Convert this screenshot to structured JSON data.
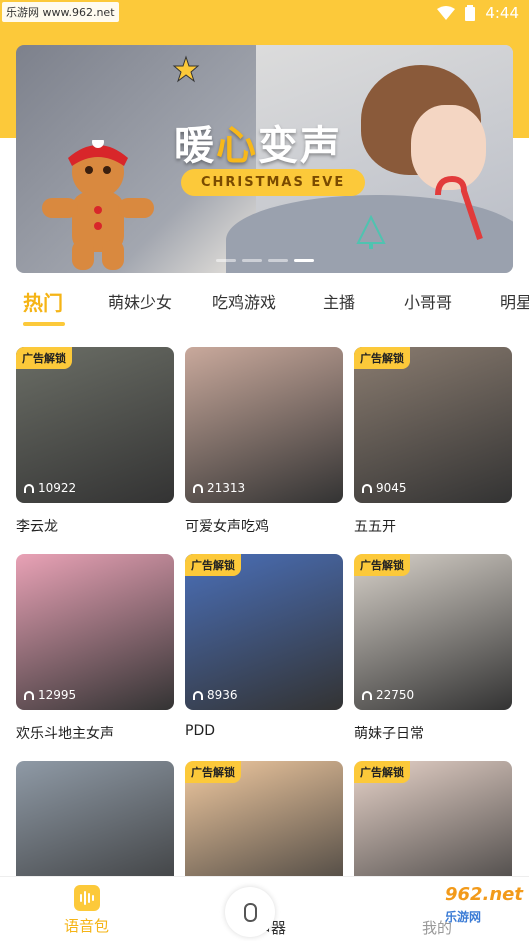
{
  "status_bar": {
    "left_text": "乐游网 www.962.net",
    "time": "4:44"
  },
  "banner": {
    "title_left": "暖",
    "title_mid": "心",
    "title_right": "变声",
    "subtitle": "CHRISTMAS EVE",
    "page_count": 4,
    "active_page": 3
  },
  "tabs": [
    "热门",
    "萌妹少女",
    "吃鸡游戏",
    "主播",
    "小哥哥",
    "明星"
  ],
  "active_tab": 0,
  "ad_badge": "广告解锁",
  "cards": [
    {
      "title": "李云龙",
      "plays": "10922",
      "ad": true,
      "color": "#6b6e66"
    },
    {
      "title": "可爱女声吃鸡",
      "plays": "21313",
      "ad": false,
      "color": "#c9a99c"
    },
    {
      "title": "五五开",
      "plays": "9045",
      "ad": true,
      "color": "#8a7c70"
    },
    {
      "title": "欢乐斗地主女声",
      "plays": "12995",
      "ad": false,
      "color": "#e9a2b6"
    },
    {
      "title": "PDD",
      "plays": "8936",
      "ad": true,
      "color": "#4a6fb8"
    },
    {
      "title": "萌妹子日常",
      "plays": "22750",
      "ad": true,
      "color": "#d7d1c9"
    },
    {
      "title": "",
      "plays": "",
      "ad": false,
      "color": "#8f9aa6"
    },
    {
      "title": "",
      "plays": "",
      "ad": true,
      "color": "#f0c9a0"
    },
    {
      "title": "",
      "plays": "",
      "ad": true,
      "color": "#e6d2c8"
    }
  ],
  "bottom_nav": [
    {
      "label": "语音包",
      "icon": "voice-pack-icon",
      "active": true
    },
    {
      "label": "变声器",
      "icon": "microphone-icon",
      "active": false
    },
    {
      "label": "我的",
      "icon": "profile-icon",
      "active": false
    }
  ],
  "watermark": {
    "main": "962.net",
    "sub": "乐游网"
  },
  "colors": {
    "accent": "#fcc93a",
    "accent_text": "#f5b416"
  }
}
